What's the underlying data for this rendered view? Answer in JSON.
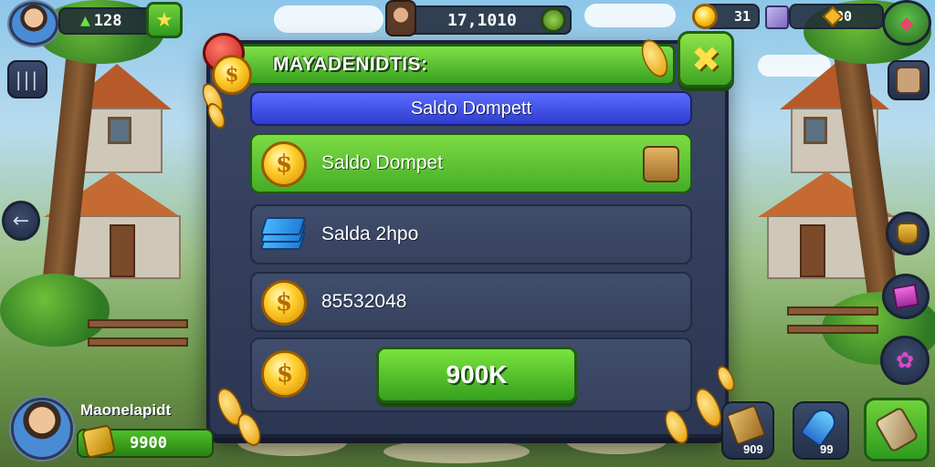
{
  "hud": {
    "top_left_value": "128",
    "top_center_value": "17,1010",
    "top_right_value_1": "31",
    "top_right_value_2": "100"
  },
  "dialog": {
    "title": "MAYADENIDTIS:",
    "subheader": "Saldo Dompett",
    "close_icon": "close-x-icon",
    "rows": [
      {
        "label": "Saldo Dompet",
        "icon": "coin-icon",
        "selected": true,
        "trailing_icon": "wallet-icon"
      },
      {
        "label": "Salda 2hpo",
        "icon": "cash-stack-icon",
        "selected": false
      },
      {
        "label": "85532048",
        "icon": "coin-icon",
        "selected": false
      }
    ],
    "buy_button_label": "900K"
  },
  "player_card": {
    "name": "Maonelapidt",
    "balance": "9900"
  },
  "bottom_right": {
    "item_1_count": "909",
    "item_2_count": "99"
  },
  "colors": {
    "accent_green": "#45ad25",
    "panel_navy": "#2b3652",
    "header_blue": "#2f3ccf",
    "coin_gold": "#ffcf2e"
  }
}
